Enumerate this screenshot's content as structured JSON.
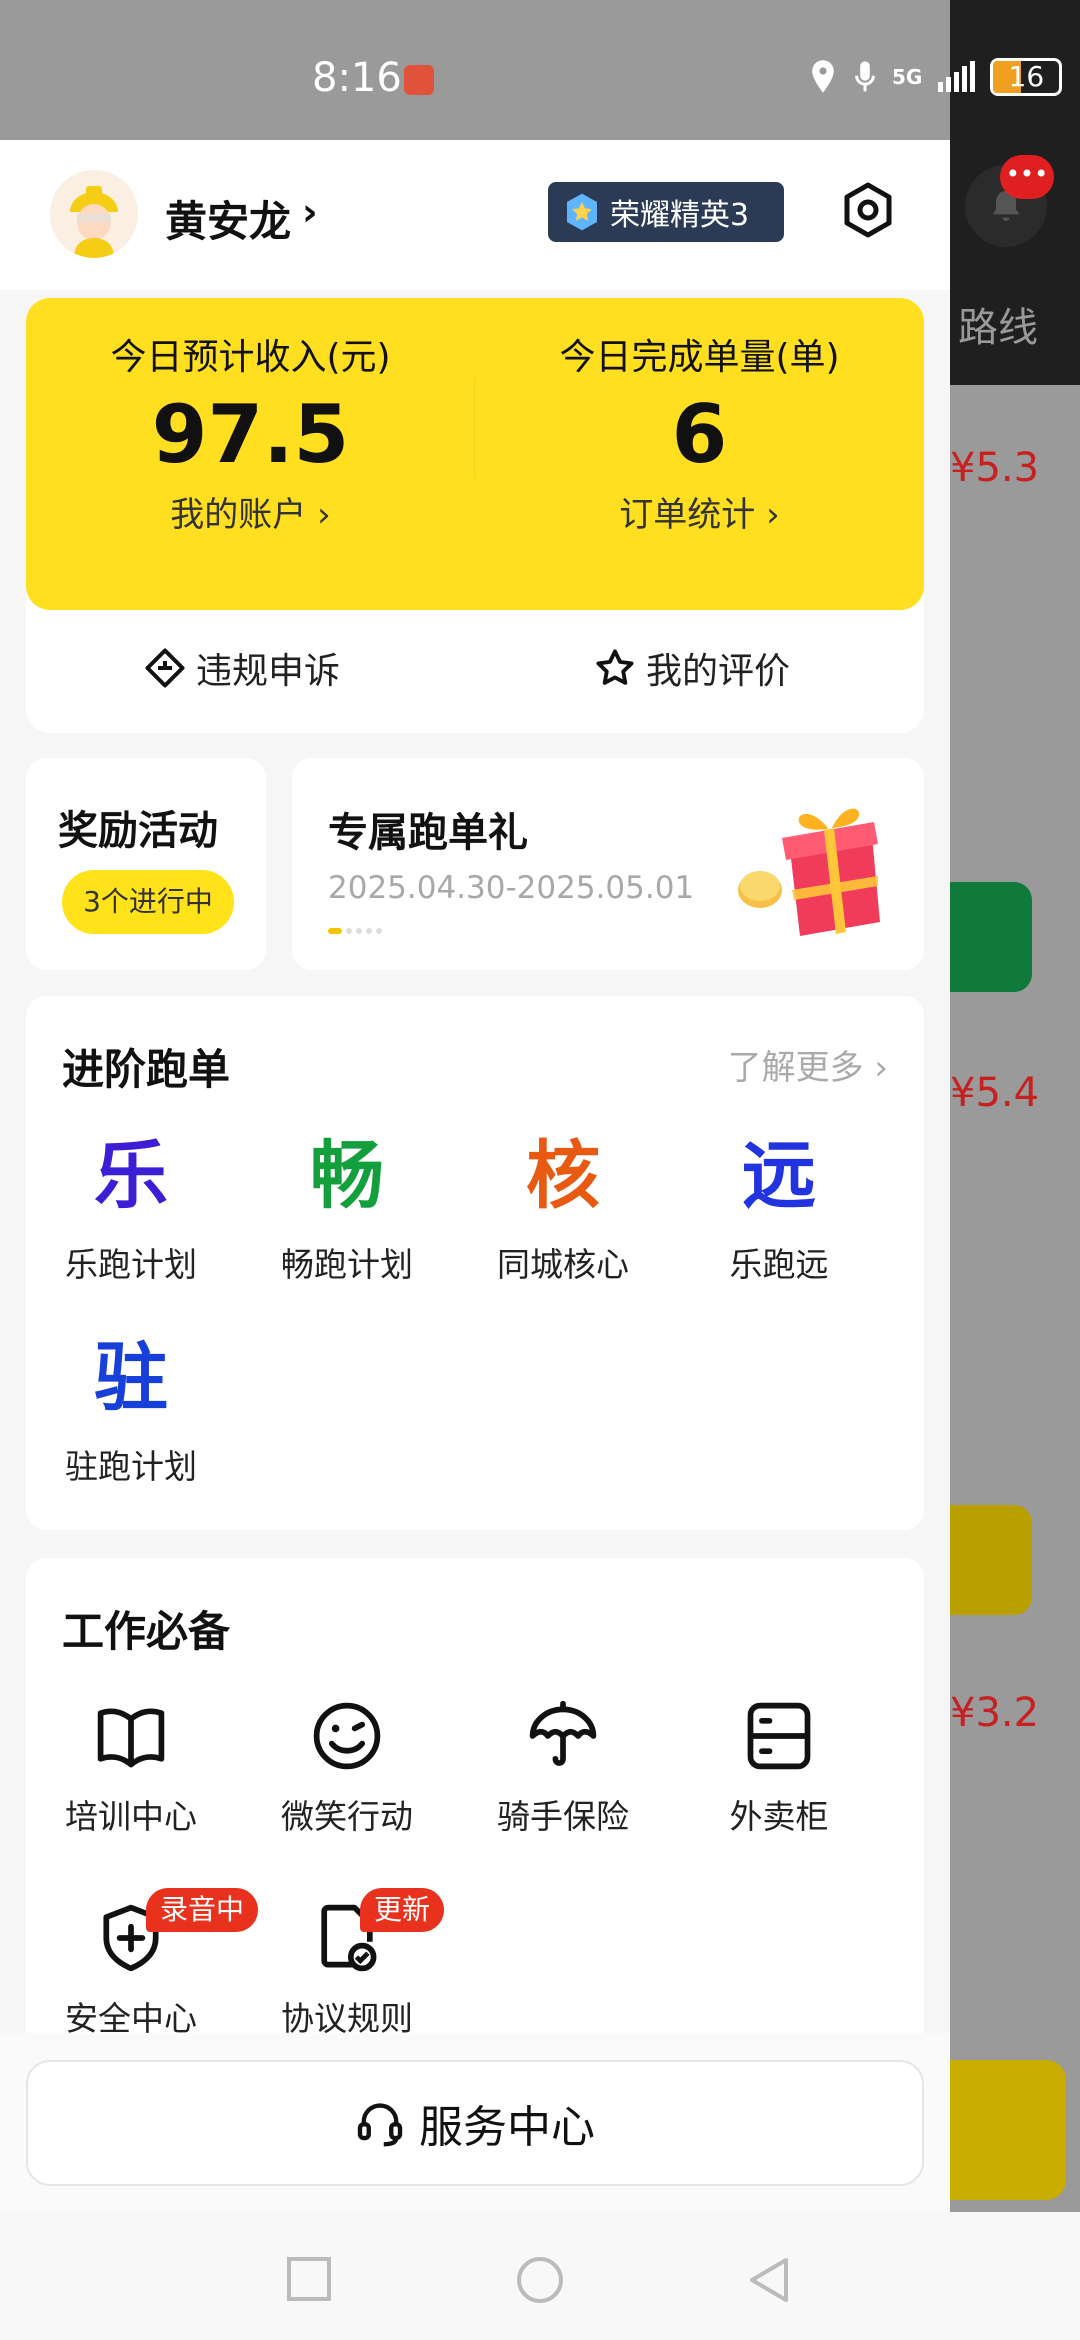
{
  "status_bar": {
    "time": "8:16",
    "network": "5G",
    "battery": "16"
  },
  "background_app": {
    "route_label": "路线",
    "notification_badge": "•••",
    "prices": [
      "¥5.3",
      "¥5.4",
      "¥3.2"
    ]
  },
  "header": {
    "user_name": "黄安龙",
    "rank": "荣耀精英3"
  },
  "earnings": {
    "income_label": "今日预计收入(元)",
    "income_value": "97.5",
    "income_link": "我的账户 ›",
    "orders_label": "今日完成单量(单)",
    "orders_value": "6",
    "orders_link": "订单统计 ›"
  },
  "actions": {
    "appeal": "违规申诉",
    "rating": "我的评价"
  },
  "reward": {
    "title": "奖励活动",
    "badge": "3个进行中"
  },
  "promo": {
    "title": "专属跑单礼",
    "date_range": "2025.04.30-2025.05.01"
  },
  "advanced": {
    "title": "进阶跑单",
    "learn_more": "了解更多",
    "items": [
      {
        "glyph": "乐",
        "label": "乐跑计划",
        "color": "#3a1fd6"
      },
      {
        "glyph": "畅",
        "label": "畅跑计划",
        "color": "#13a03c"
      },
      {
        "glyph": "核",
        "label": "同城核心",
        "color": "#e85a12"
      },
      {
        "glyph": "远",
        "label": "乐跑远",
        "color": "#2233e0"
      },
      {
        "glyph": "驻",
        "label": "驻跑计划",
        "color": "#1740d8"
      }
    ]
  },
  "tools": {
    "title": "工作必备",
    "items": [
      {
        "label": "培训中心",
        "icon": "book-icon"
      },
      {
        "label": "微笑行动",
        "icon": "smile-icon"
      },
      {
        "label": "骑手保险",
        "icon": "umbrella-icon"
      },
      {
        "label": "外卖柜",
        "icon": "locker-icon"
      },
      {
        "label": "安全中心",
        "icon": "shield-icon",
        "tag": "录音中"
      },
      {
        "label": "协议规则",
        "icon": "document-check-icon",
        "tag": "更新"
      }
    ]
  },
  "service": {
    "label": "服务中心"
  },
  "colors": {
    "accent_yellow": "#ffdf20",
    "badge_red": "#e8321e",
    "rank_navy": "#2b3a55"
  }
}
